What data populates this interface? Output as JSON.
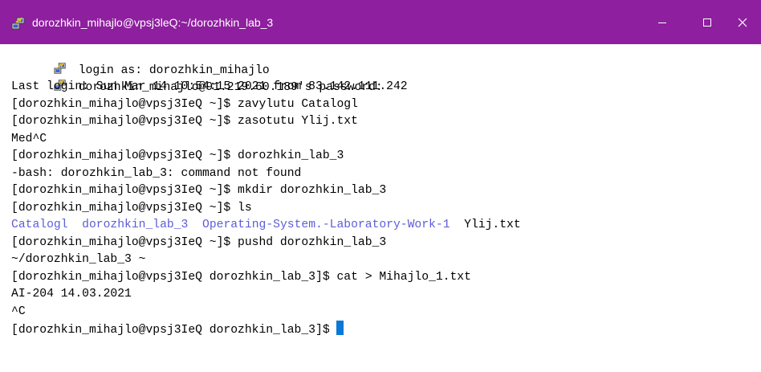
{
  "window": {
    "title": "dorozhkin_mihajlo@vpsj3leQ:~/dorozhkin_lab_3",
    "controls": {
      "minimize": "minimize-icon",
      "maximize": "maximize-icon",
      "close": "close-icon"
    },
    "colors": {
      "titlebar": "#8e1f9e",
      "ls_dir": "#5d5dd8",
      "cursor": "#0a78d7"
    }
  },
  "terminal": {
    "lines": [
      " login as: dorozhkin_mihajlo",
      " dorozhkin_mihajlo@91.219.60.189's password:",
      "Last login: Sun Mar 14 10:54:15 2021 from 83.142.111.242",
      "[dorozhkin_mihajlo@vpsj3IeQ ~]$ zavylutu Catalogl",
      "[dorozhkin_mihajlo@vpsj3IeQ ~]$ zasotutu Ylij.txt",
      "Med^C",
      "[dorozhkin_mihajlo@vpsj3IeQ ~]$ dorozhkin_lab_3",
      "-bash: dorozhkin_lab_3: command not found",
      "[dorozhkin_mihajlo@vpsj3IeQ ~]$ mkdir dorozhkin_lab_3",
      "[dorozhkin_mihajlo@vpsj3IeQ ~]$ ls",
      "",
      "[dorozhkin_mihajlo@vpsj3IeQ ~]$ pushd dorozhkin_lab_3",
      "~/dorozhkin_lab_3 ~",
      "[dorozhkin_mihajlo@vpsj3IeQ dorozhkin_lab_3]$ cat > Mihajlo_1.txt",
      "AI-204 14.03.2021",
      "^C",
      "[dorozhkin_mihajlo@vpsj3IeQ dorozhkin_lab_3]$ "
    ],
    "ls_output": {
      "dir1": "Catalogl",
      "dir2": "dorozhkin_lab_3",
      "dir3": "Operating-System.-Laboratory-Work-1",
      "file1": "Ylij.txt"
    }
  }
}
